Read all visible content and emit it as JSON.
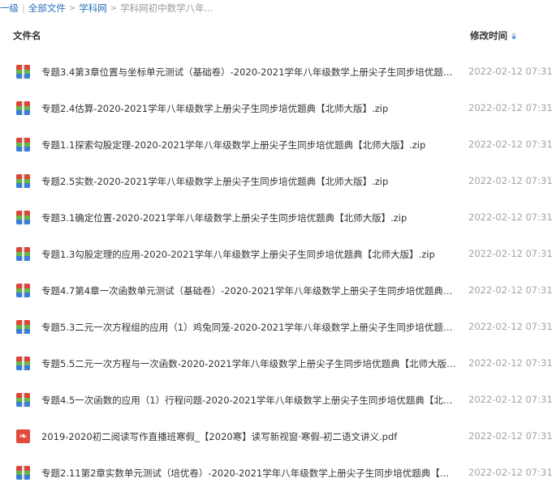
{
  "breadcrumb": {
    "back_label": "一级",
    "all_files_label": "全部文件",
    "site_label": "学科网",
    "current_label": "学科网初中数学八年..."
  },
  "header": {
    "name_label": "文件名",
    "time_label": "修改时间"
  },
  "files": [
    {
      "name": "专题3.4第3章位置与坐标单元测试（基础卷）-2020-2021学年八年级数学上册尖子生同步培优题典【北师...",
      "time": "2022-02-12 07:31",
      "type": "zip"
    },
    {
      "name": "专题2.4估算-2020-2021学年八年级数学上册尖子生同步培优题典【北师大版】.zip",
      "time": "2022-02-12 07:31",
      "type": "zip"
    },
    {
      "name": "专题1.1探索勾股定理-2020-2021学年八年级数学上册尖子生同步培优题典【北师大版】.zip",
      "time": "2022-02-12 07:31",
      "type": "zip"
    },
    {
      "name": "专题2.5实数-2020-2021学年八年级数学上册尖子生同步培优题典【北师大版】.zip",
      "time": "2022-02-12 07:31",
      "type": "zip"
    },
    {
      "name": "专题3.1确定位置-2020-2021学年八年级数学上册尖子生同步培优题典【北师大版】.zip",
      "time": "2022-02-12 07:31",
      "type": "zip"
    },
    {
      "name": "专题1.3勾股定理的应用-2020-2021学年八年级数学上册尖子生同步培优题典【北师大版】.zip",
      "time": "2022-02-12 07:31",
      "type": "zip"
    },
    {
      "name": "专题4.7第4章一次函数单元测试（基础卷）-2020-2021学年八年级数学上册尖子生同步培优题典【北师大...",
      "time": "2022-02-12 07:31",
      "type": "zip"
    },
    {
      "name": "专题5.3二元一次方程组的应用（1）鸡兔同笼-2020-2021学年八年级数学上册尖子生同步培优题典【北师...",
      "time": "2022-02-12 07:31",
      "type": "zip"
    },
    {
      "name": "专题5.5二元一次方程与一次函数-2020-2021学年八年级数学上册尖子生同步培优题典【北师大版】.zip",
      "time": "2022-02-12 07:31",
      "type": "zip"
    },
    {
      "name": "专题4.5一次函数的应用（1）行程问题-2020-2021学年八年级数学上册尖子生同步培优题典【北师大版】...",
      "time": "2022-02-12 07:31",
      "type": "zip"
    },
    {
      "name": "2019-2020初二阅读写作直播班寒假_【2020寒】读写新视窗·寒假-初二语文讲义.pdf",
      "time": "2022-02-12 07:31",
      "type": "pdf"
    },
    {
      "name": "专题2.11第2章实数单元测试（培优卷）-2020-2021学年八年级数学上册尖子生同步培优题典【北师大版...",
      "time": "2022-02-12 07:31",
      "type": "zip"
    }
  ]
}
